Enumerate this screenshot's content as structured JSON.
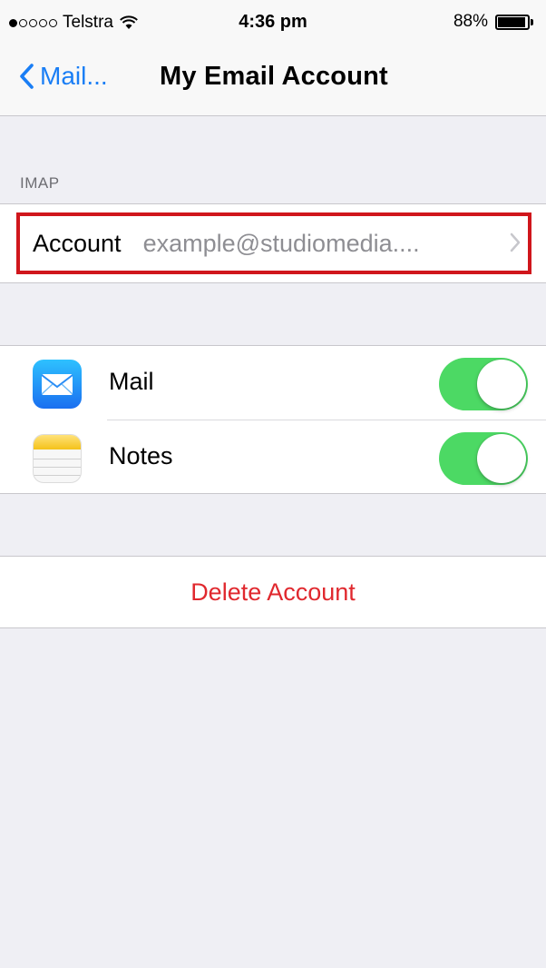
{
  "status_bar": {
    "carrier": "Telstra",
    "signal_bars_filled": 1,
    "signal_bars_total": 5,
    "time": "4:36 pm",
    "battery_percent": "88%",
    "battery_level": 0.88
  },
  "nav": {
    "back_label": "Mail...",
    "title": "My Email Account"
  },
  "imap_section": {
    "header": "IMAP",
    "account_label": "Account",
    "account_value": "example@studiomedia...."
  },
  "services": [
    {
      "label": "Mail",
      "icon": "mail-app-icon",
      "enabled": true
    },
    {
      "label": "Notes",
      "icon": "notes-app-icon",
      "enabled": true
    }
  ],
  "delete_label": "Delete Account",
  "colors": {
    "accent_blue": "#1a7ef5",
    "toggle_on": "#4cd964",
    "destructive": "#e0282e",
    "highlight_box": "#d0161c",
    "background": "#efeff4"
  }
}
